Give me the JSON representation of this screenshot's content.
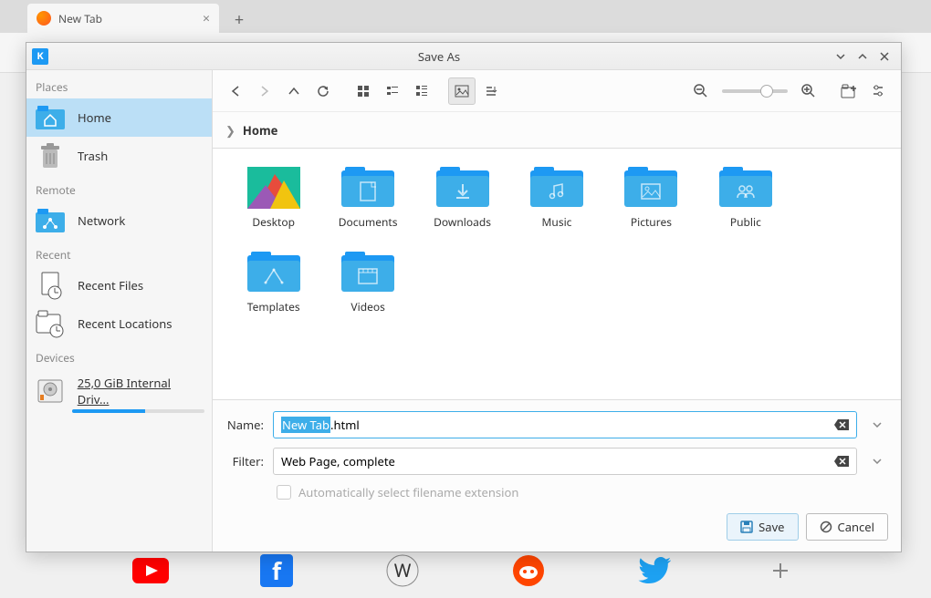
{
  "browser": {
    "tab_label": "New Tab",
    "new_tab_glyph": "+",
    "close_glyph": "×"
  },
  "dialog": {
    "title": "Save As"
  },
  "sidebar": {
    "sections": {
      "places": "Places",
      "remote": "Remote",
      "recent": "Recent",
      "devices": "Devices"
    },
    "home": "Home",
    "trash": "Trash",
    "network": "Network",
    "recent_files": "Recent Files",
    "recent_locations": "Recent Locations",
    "drive": "25,0 GiB Internal Driv..."
  },
  "breadcrumb": {
    "home": "Home"
  },
  "folders": {
    "desktop": "Desktop",
    "documents": "Documents",
    "downloads": "Downloads",
    "music": "Music",
    "pictures": "Pictures",
    "public": "Public",
    "templates": "Templates",
    "videos": "Videos"
  },
  "form": {
    "name_label": "Name:",
    "filter_label": "Filter:",
    "name_selected": "New Tab",
    "name_rest": ".html",
    "filter_value": "Web Page, complete",
    "auto_ext": "Automatically select filename extension",
    "save": "Save",
    "cancel": "Cancel"
  }
}
